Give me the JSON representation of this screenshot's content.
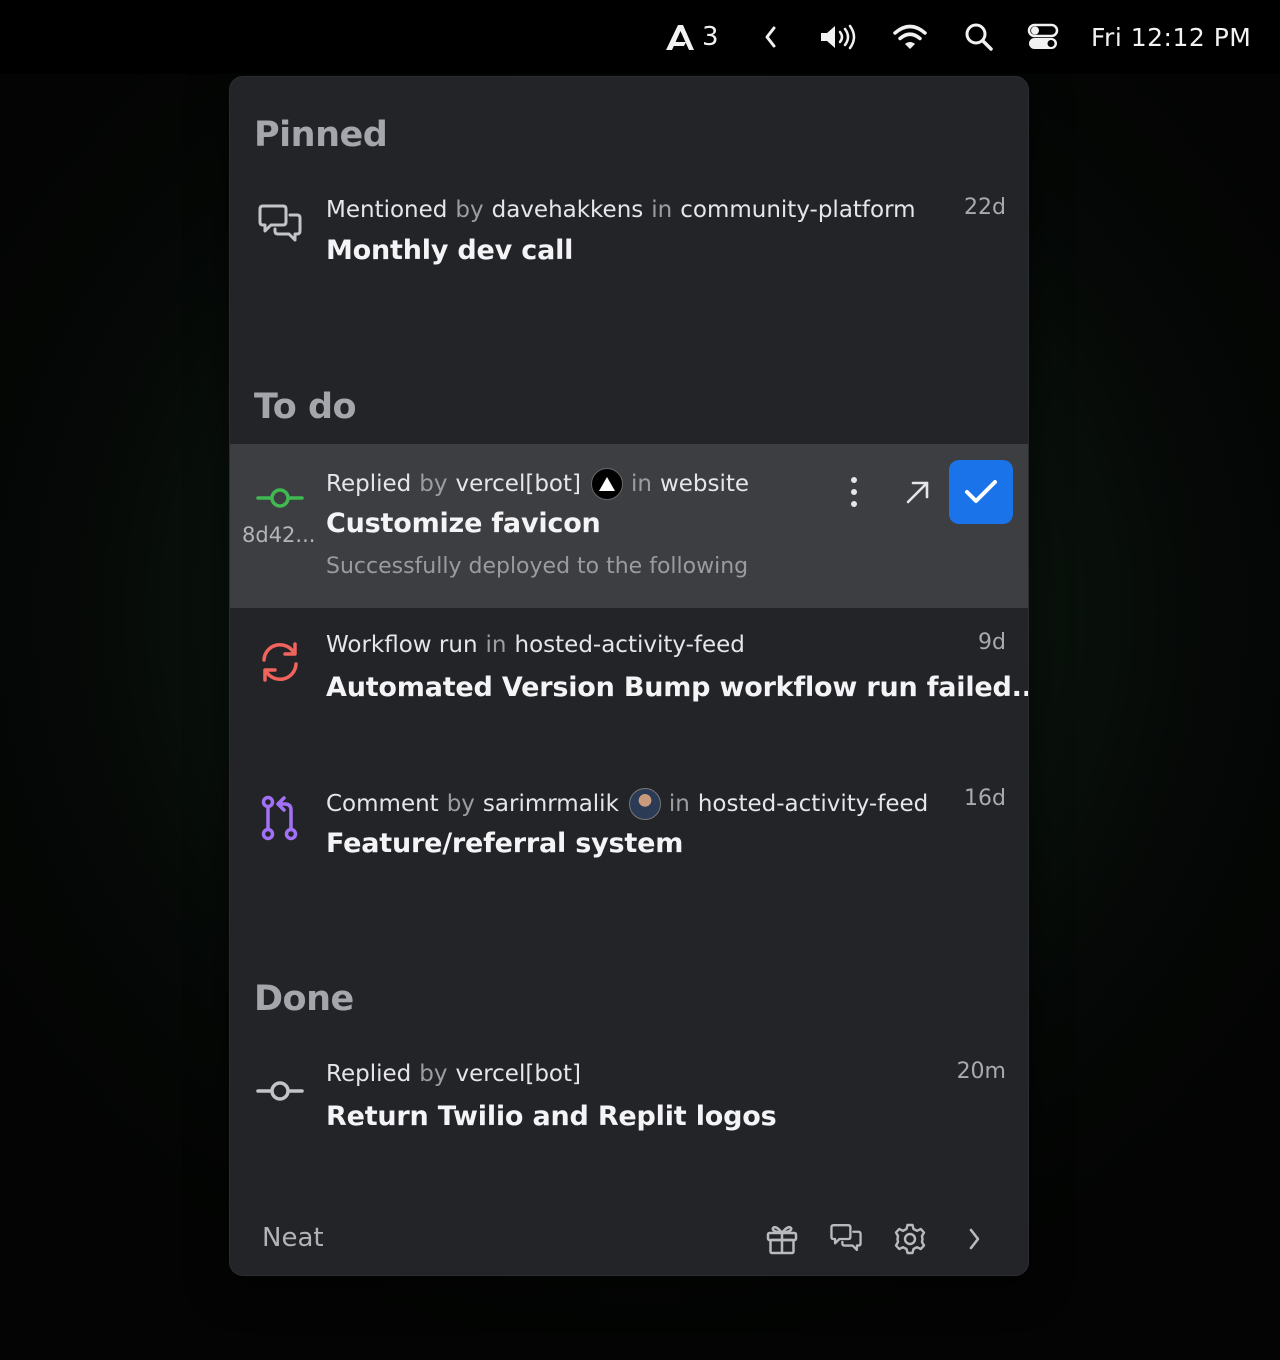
{
  "menubar": {
    "app_count": "3",
    "clock": "Fri 12:12 PM",
    "icons": [
      "app-logo-icon",
      "chevron-left-icon",
      "volume-icon",
      "wifi-icon",
      "search-icon",
      "control-center-icon"
    ]
  },
  "sections": {
    "pinned": "Pinned",
    "todo": "To do",
    "done": "Done"
  },
  "pinned": [
    {
      "icon": "discussion-icon",
      "reason": "Mentioned",
      "by": "by",
      "user": "davehakkens",
      "in": "in",
      "repo": "community-platform",
      "title": "Monthly dev call",
      "age": "22d"
    }
  ],
  "todo": [
    {
      "icon": "commit-icon",
      "sha": "8d42...",
      "reason": "Replied",
      "by": "by",
      "user": "vercel[bot]",
      "in": "in",
      "repo": "website",
      "title": "Customize favicon",
      "body": "Successfully deployed to the following",
      "active": true,
      "icon_color": "#3fb950"
    },
    {
      "icon": "workflow-sync-icon",
      "reason": "Workflow run",
      "in": "in",
      "repo": "hosted-activity-feed",
      "title": "Automated Version Bump workflow run failed...",
      "age": "9d",
      "icon_color": "#f0645d"
    },
    {
      "icon": "pull-request-icon",
      "reason": "Comment",
      "by": "by",
      "user": "sarimrmalik",
      "in": "in",
      "repo": "hosted-activity-feed",
      "title": "Feature/referral system",
      "age": "16d",
      "icon_color": "#a371f7"
    }
  ],
  "done": [
    {
      "icon": "commit-icon",
      "reason": "Replied",
      "by": "by",
      "user": "vercel[bot]",
      "title": "Return Twilio and Replit logos",
      "age": "20m"
    }
  ],
  "footer": {
    "brand": "Neat",
    "icons": [
      "gift-icon",
      "feedback-icon",
      "settings-icon",
      "chevron-right-icon"
    ]
  },
  "colors": {
    "accent": "#1a73e8",
    "panel_bg": "#232428",
    "active_row_bg": "#3d3e42"
  }
}
